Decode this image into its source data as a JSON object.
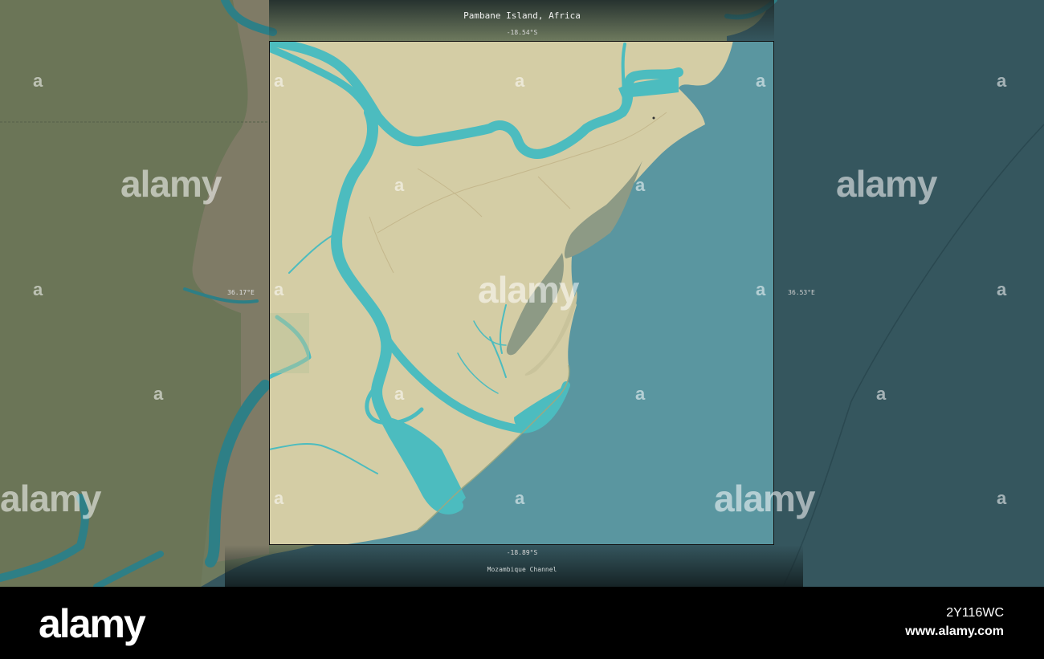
{
  "map": {
    "title": "Pambane Island, Africa",
    "lat_top": "-18.54°S",
    "lat_bottom": "-18.89°S",
    "lon_left": "36.17°E",
    "lon_right": "36.53°E",
    "water_label": "Mozambique Channel"
  },
  "colors": {
    "land_outside": "#6e7a5e",
    "land_highlight": "#d4cda5",
    "sea_outside": "#35565e",
    "sea_highlight": "#5a96a0",
    "river": "#4cbcbf",
    "footer": "#000000"
  },
  "watermark": {
    "brand": "alamy",
    "small_mark": "a"
  },
  "footer": {
    "logo": "alamy",
    "image_id": "2Y116WC",
    "url": "www.alamy.com"
  }
}
